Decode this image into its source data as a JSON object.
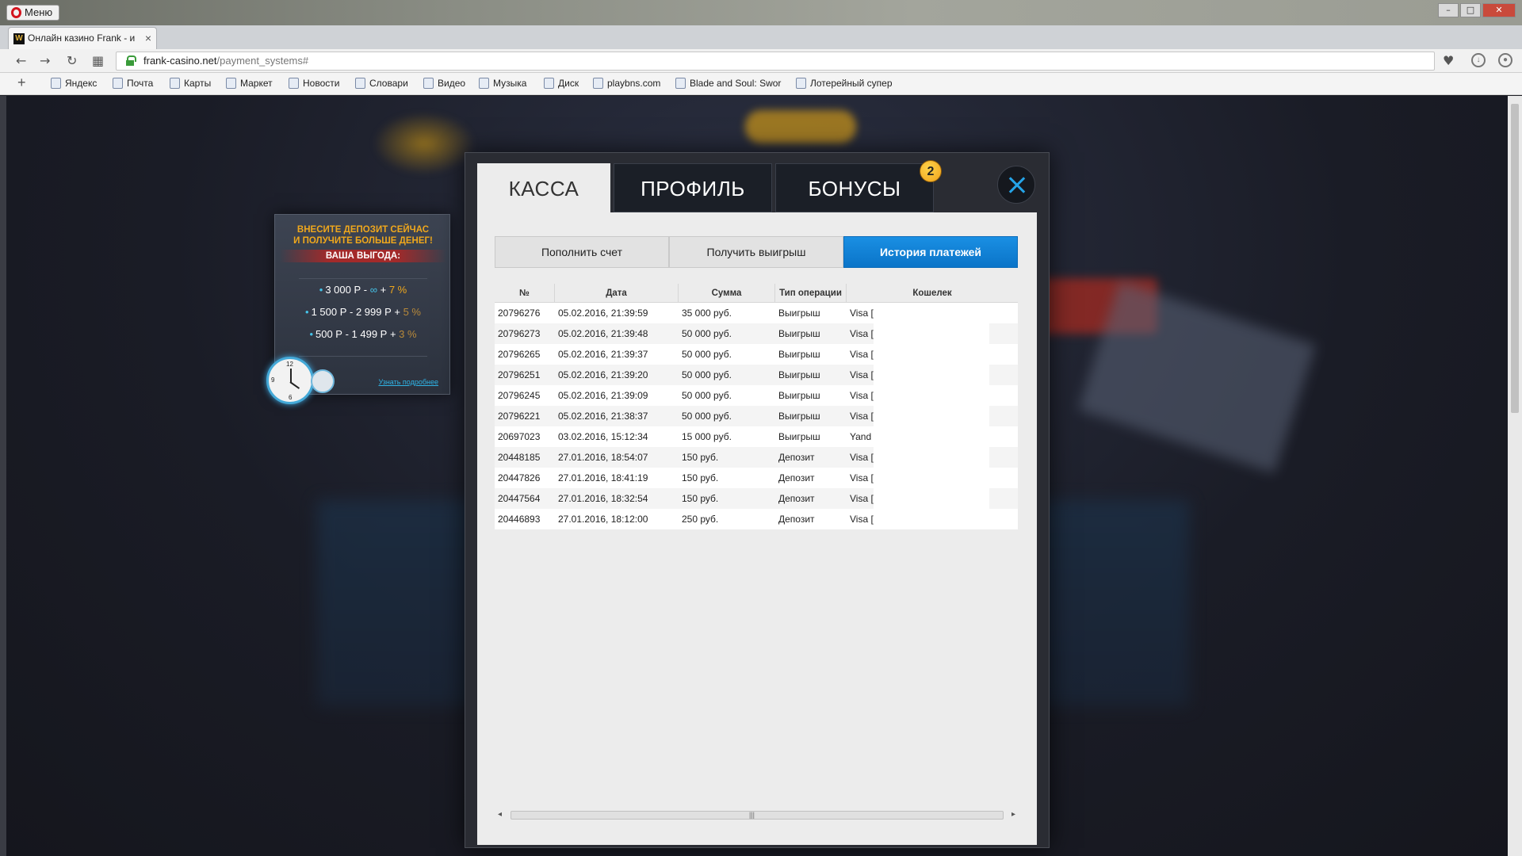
{
  "browser": {
    "menu_label": "Меню",
    "tab_title": "Онлайн казино Frank - и",
    "favicon": "W",
    "url_host": "frank-casino.net",
    "url_path": "/payment_systems#",
    "bookmarks": [
      "Яндекс",
      "Почта",
      "Карты",
      "Маркет",
      "Новости",
      "Словари",
      "Видео",
      "Музыка",
      "Диск",
      "playbns.com",
      "Blade and Soul: Swor",
      "Лотерейный супер"
    ]
  },
  "promo": {
    "title_line1": "ВНЕСИТЕ ДЕПОЗИТ СЕЙЧАС",
    "title_line2": "И ПОЛУЧИТЕ БОЛЬШЕ ДЕНЕГ!",
    "subtitle": "ВАША ВЫГОДА:",
    "tier1_range": "3 000 Р - ",
    "tier1_tilde": "∞",
    "tier1_plus": " + ",
    "tier1_pct": "7 %",
    "tier2_range": "1 500 Р - 2 999 Р + ",
    "tier2_pct": "5 %",
    "tier3_range": "500 Р - 1 499 Р + ",
    "tier3_pct": "3 %",
    "link": "Узнать подробнее",
    "clock_12": "12",
    "clock_9": "9",
    "clock_6": "6"
  },
  "modal": {
    "tabs": [
      "КАССА",
      "ПРОФИЛЬ",
      "БОНУСЫ"
    ],
    "active_tab": "КАССА",
    "bonus_badge": "2",
    "subtabs": [
      "Пополнить счет",
      "Получить выигрыш",
      "История платежей"
    ],
    "active_subtab": "История платежей",
    "accent_color": "#0a74c8"
  },
  "history": {
    "columns": [
      "№",
      "Дата",
      "Сумма",
      "Тип операции",
      "Кошелек"
    ],
    "rows": [
      [
        "20796276",
        "05.02.2016, 21:39:59",
        "35 000 руб.",
        "Выигрыш",
        "Visa ["
      ],
      [
        "20796273",
        "05.02.2016, 21:39:48",
        "50 000 руб.",
        "Выигрыш",
        "Visa ["
      ],
      [
        "20796265",
        "05.02.2016, 21:39:37",
        "50 000 руб.",
        "Выигрыш",
        "Visa ["
      ],
      [
        "20796251",
        "05.02.2016, 21:39:20",
        "50 000 руб.",
        "Выигрыш",
        "Visa ["
      ],
      [
        "20796245",
        "05.02.2016, 21:39:09",
        "50 000 руб.",
        "Выигрыш",
        "Visa ["
      ],
      [
        "20796221",
        "05.02.2016, 21:38:37",
        "50 000 руб.",
        "Выигрыш",
        "Visa ["
      ],
      [
        "20697023",
        "03.02.2016, 15:12:34",
        "15 000 руб.",
        "Выигрыш",
        "Yand"
      ],
      [
        "20448185",
        "27.01.2016, 18:54:07",
        "150 руб.",
        "Депозит",
        "Visa ["
      ],
      [
        "20447826",
        "27.01.2016, 18:41:19",
        "150 руб.",
        "Депозит",
        "Visa ["
      ],
      [
        "20447564",
        "27.01.2016, 18:32:54",
        "150 руб.",
        "Депозит",
        "Visa ["
      ],
      [
        "20446893",
        "27.01.2016, 18:12:00",
        "250 руб.",
        "Депозит",
        "Visa ["
      ]
    ]
  },
  "scrollbar": {
    "left_arrow": "◂",
    "right_arrow": "▸",
    "grip": "|||"
  }
}
